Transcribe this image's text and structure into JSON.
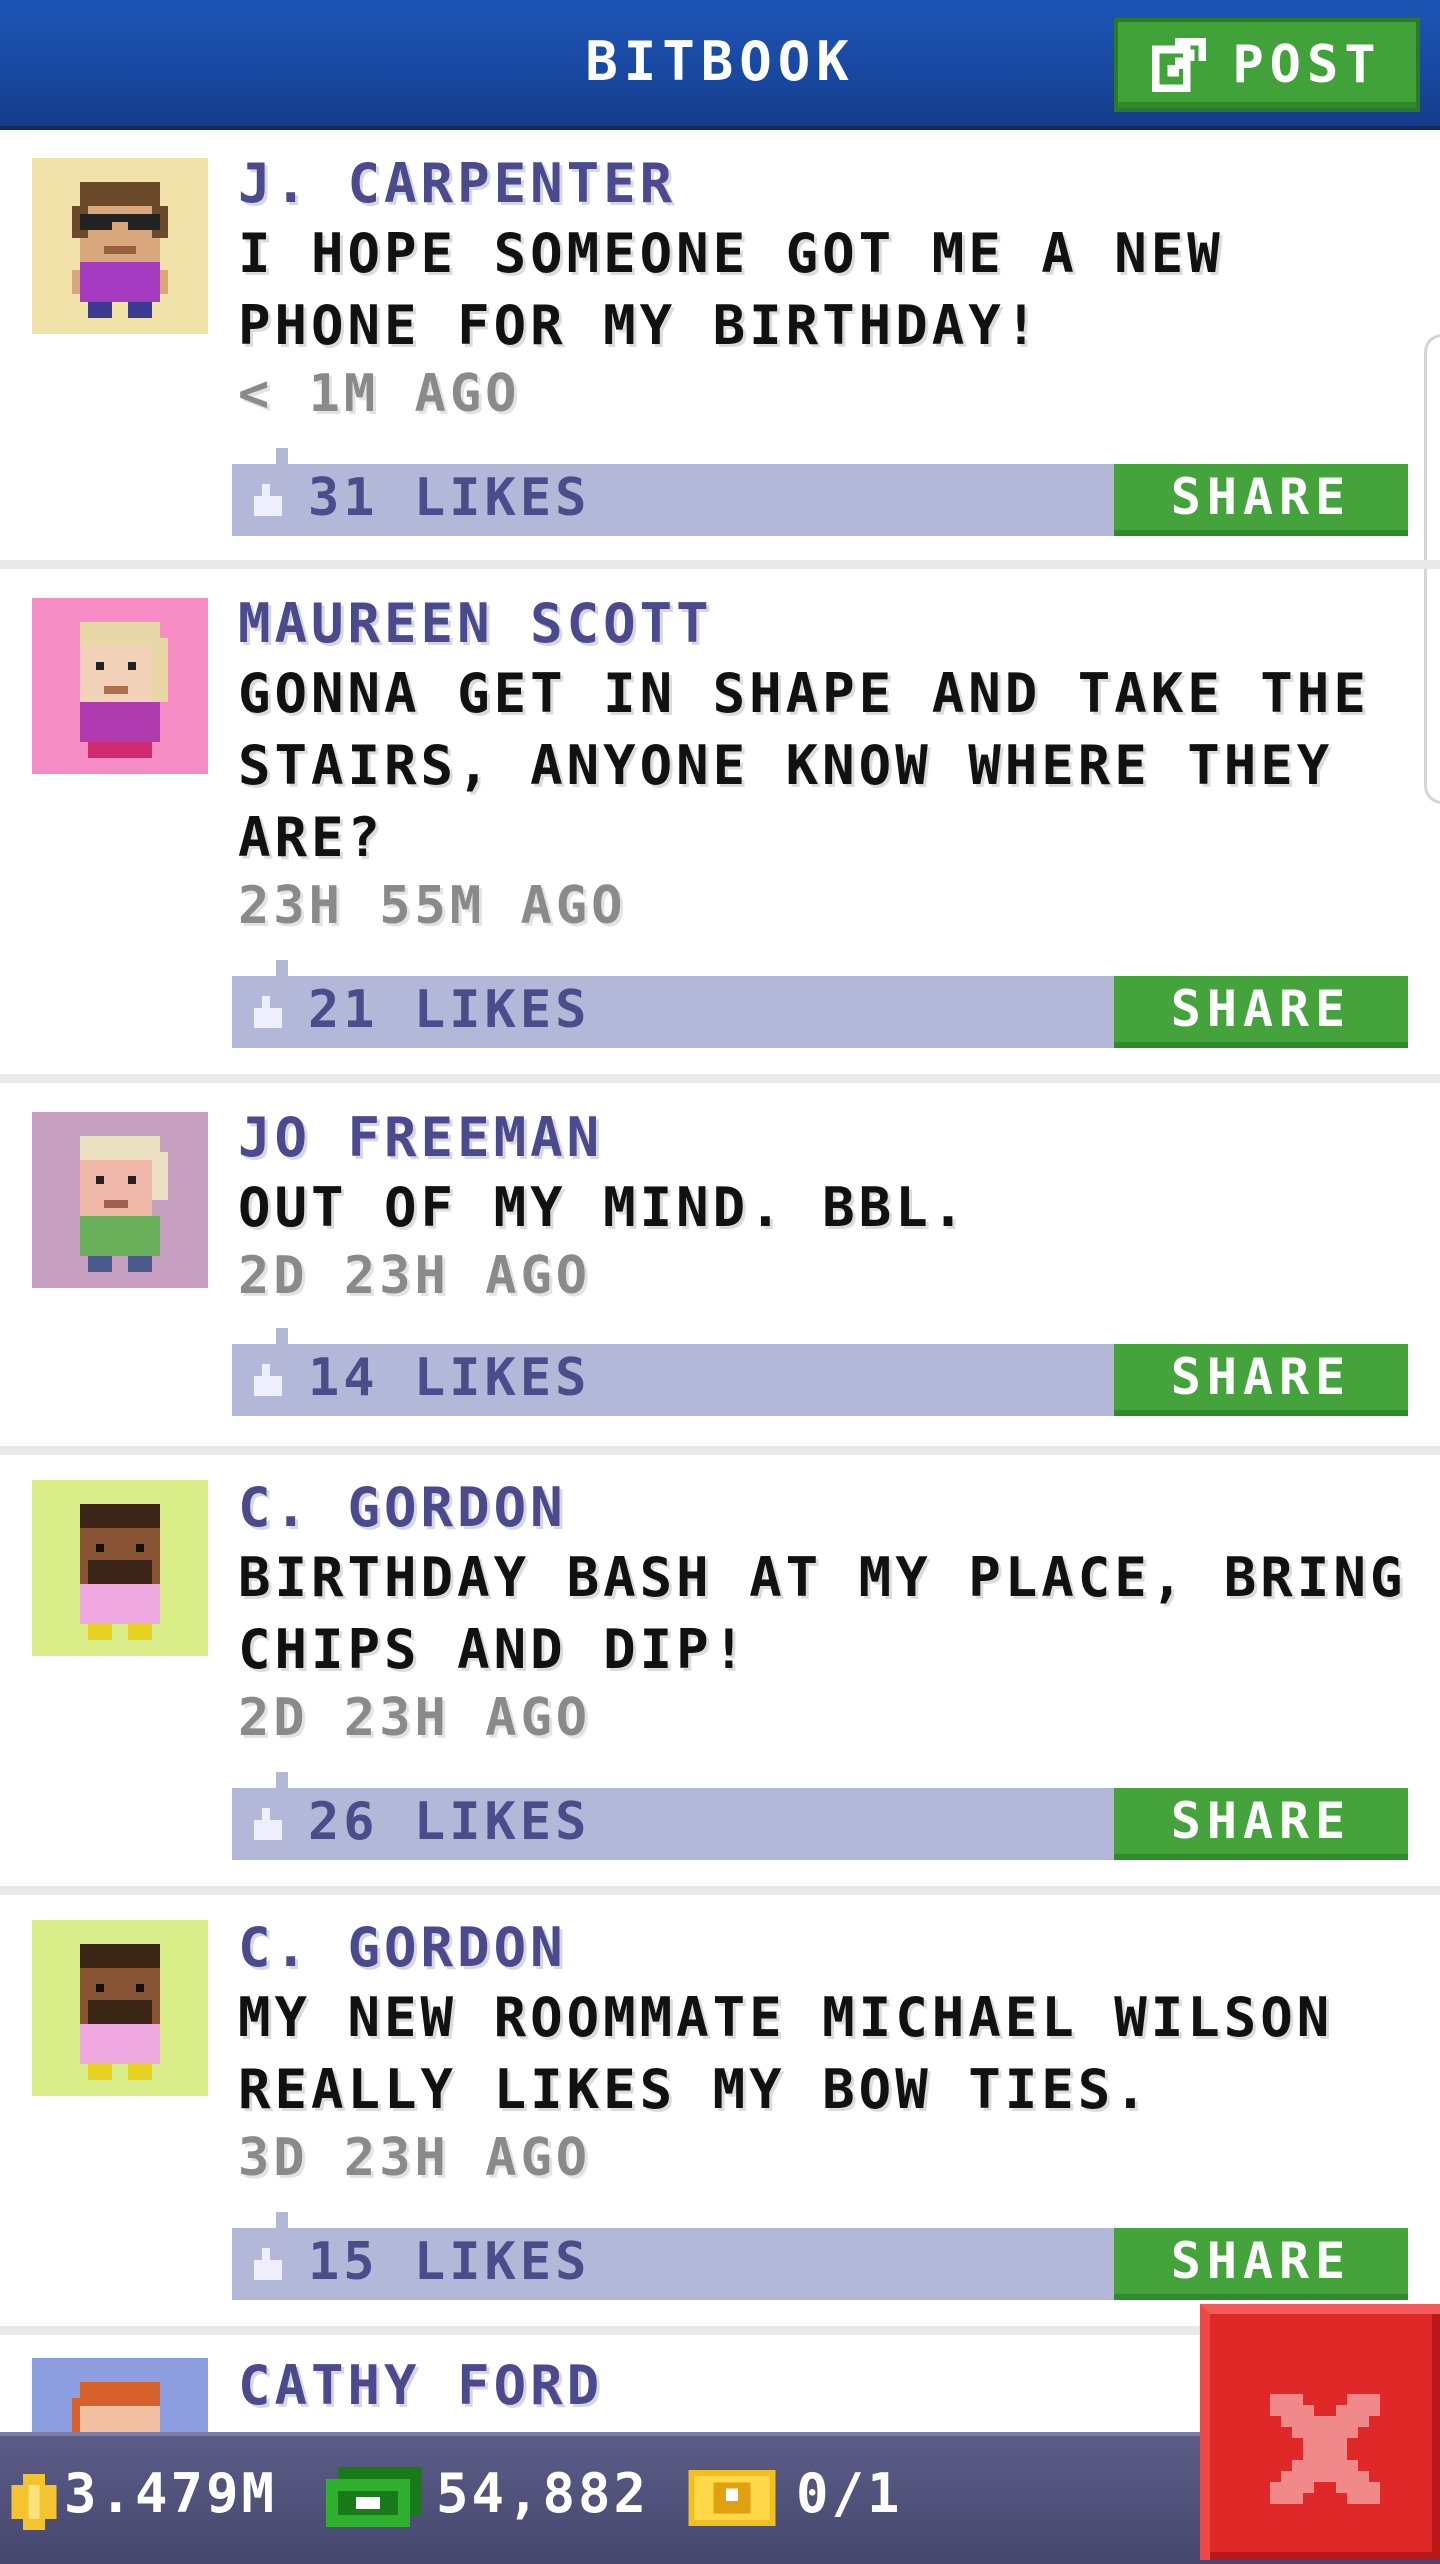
{
  "header": {
    "title": "BITBOOK",
    "post_label": "POST"
  },
  "posts": [
    {
      "author": "J. CARPENTER",
      "message": "I HOPE SOMEONE GOT ME A NEW PHONE FOR MY BIRTHDAY!",
      "time": "< 1M AGO",
      "likes": "31 LIKES",
      "share_label": "SHARE",
      "avatar_bg": "#f0e2a8",
      "avatar": "woman-glasses-purple"
    },
    {
      "author": "MAUREEN SCOTT",
      "message": "GONNA GET IN SHAPE AND TAKE THE STAIRS, ANYONE KNOW WHERE THEY ARE?",
      "time": "23H 55M AGO",
      "likes": "21 LIKES",
      "share_label": "SHARE",
      "avatar_bg": "#f58cc4",
      "avatar": "blonde-woman-purple"
    },
    {
      "author": "JO FREEMAN",
      "message": "OUT OF MY MIND. BBL.",
      "time": "2D 23H AGO",
      "likes": "14 LIKES",
      "share_label": "SHARE",
      "avatar_bg": "#c59ec0",
      "avatar": "elder-green-shirt"
    },
    {
      "author": "C. GORDON",
      "message": "BIRTHDAY BASH AT MY PLACE, BRING CHIPS AND DIP!",
      "time": "2D 23H AGO",
      "likes": "26 LIKES",
      "share_label": "SHARE",
      "avatar_bg": "#d8ec88",
      "avatar": "bearded-man-pink"
    },
    {
      "author": "C. GORDON",
      "message": "MY NEW ROOMMATE MICHAEL WILSON REALLY LIKES MY BOW TIES.",
      "time": "3D 23H AGO",
      "likes": "15 LIKES",
      "share_label": "SHARE",
      "avatar_bg": "#d8ec88",
      "avatar": "bearded-man-pink"
    },
    {
      "author": "CATHY FORD",
      "avatar_bg": "#8c9ee0",
      "avatar": "redhead-woman"
    }
  ],
  "bottom_bar": {
    "coins": "3.479M",
    "bux": "54,882",
    "tickets": "0/1"
  },
  "colors": {
    "header": "#1848a0",
    "post_button": "#42a23a",
    "like_bar": "#b4b8d8",
    "share": "#44a33b",
    "close": "#e02828"
  }
}
